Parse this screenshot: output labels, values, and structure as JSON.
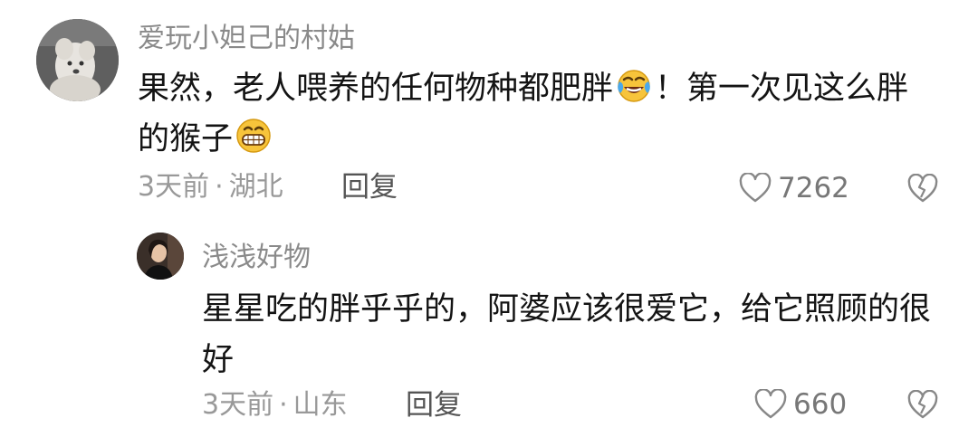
{
  "comments": [
    {
      "username": "爱玩小妲己的村姑",
      "avatar_icon": "dog-avatar",
      "text_part1": "果然，老人喂养的任何物种都肥胖",
      "emoji_1": "laughing-tears-emoji",
      "text_part2": "！第一次见这么胖的猴子",
      "emoji_2": "grinning-emoji",
      "time": "3天前",
      "separator": "·",
      "location": "湖北",
      "reply_label": "回复",
      "like_count": "7262",
      "like_icon": "heart-icon",
      "dislike_icon": "broken-heart-icon"
    }
  ],
  "replies": [
    {
      "username": "浅浅好物",
      "avatar_icon": "person-avatar",
      "text": "星星吃的胖乎乎的，阿婆应该很爱它，给它照顾的很好",
      "time": "3天前",
      "separator": "·",
      "location": "山东",
      "reply_label": "回复",
      "like_count": "660",
      "like_icon": "heart-icon",
      "dislike_icon": "broken-heart-icon"
    }
  ]
}
